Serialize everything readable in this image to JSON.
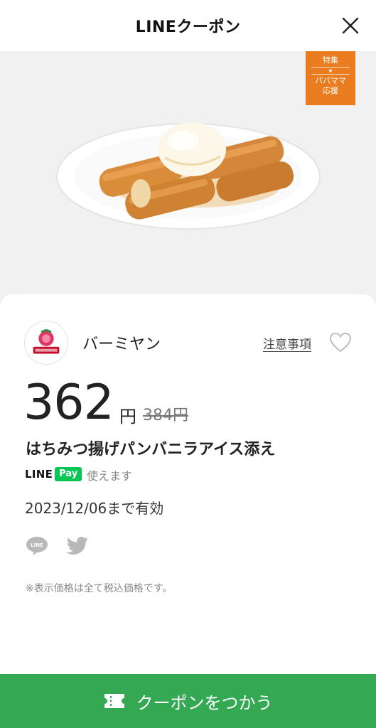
{
  "header": {
    "title": "LINEクーポン"
  },
  "badge": {
    "line1": "特集",
    "star": "★",
    "line2": "パパママ",
    "line3": "応援"
  },
  "shop": {
    "name": "バーミヤン",
    "notes_link": "注意事項"
  },
  "coupon": {
    "price": "362",
    "yen": "円",
    "original_price": "384円",
    "item_name": "はちみつ揚げパンバニラアイス添え",
    "expiry": "2023/12/06まで有効",
    "tax_note": "※表示価格は全て税込価格です。"
  },
  "linepay": {
    "line": "LINE",
    "pay": "Pay",
    "status": "使えます"
  },
  "share": {
    "line_icon_text": "LINE"
  },
  "action": {
    "use_coupon": "クーポンをつかう"
  },
  "colors": {
    "brand_green": "#34a853",
    "line_green": "#06c755",
    "badge_orange": "#e97c1e"
  }
}
